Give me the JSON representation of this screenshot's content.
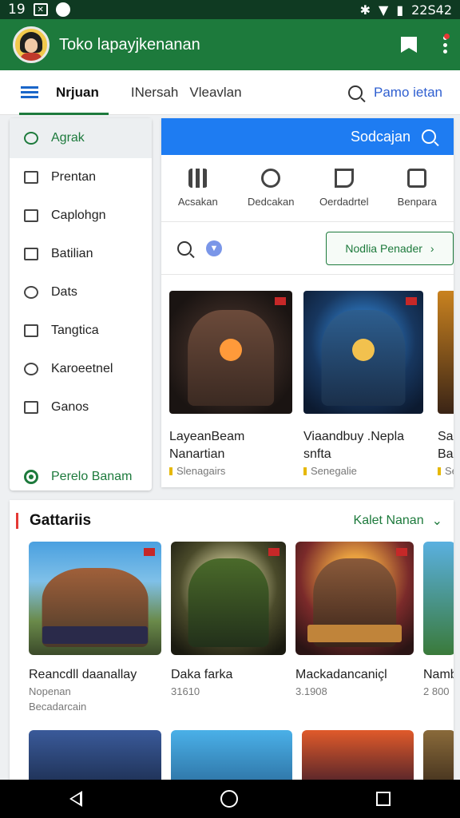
{
  "status_bar": {
    "time": "19",
    "clock": "22S42"
  },
  "app_bar": {
    "title": "Toko lapayjkenanan"
  },
  "tabs": {
    "items": [
      {
        "label": "Nrjuan",
        "active": true
      },
      {
        "label": "INersah"
      },
      {
        "label": "Vleavlan"
      }
    ],
    "search_label": "Pamo ietan"
  },
  "sidebar": {
    "items": [
      {
        "label": "Agrak",
        "icon": "search-icon",
        "active": true
      },
      {
        "label": "Prentan",
        "icon": "card-icon"
      },
      {
        "label": "Caplohgn",
        "icon": "chart-icon"
      },
      {
        "label": "Batilian",
        "icon": "calendar-icon"
      },
      {
        "label": "Dats",
        "icon": "tag-icon"
      },
      {
        "label": "Tangtica",
        "icon": "bag-icon"
      },
      {
        "label": "Karoeetnel",
        "icon": "wrench-icon"
      },
      {
        "label": "Ganos",
        "icon": "apps-icon"
      }
    ],
    "footer_label": "Perelo Banam"
  },
  "panel": {
    "header_label": "Sodcajan",
    "categories": [
      {
        "label": "Acsakan",
        "icon": "grid-icon"
      },
      {
        "label": "Dedcakan",
        "icon": "circle-icon"
      },
      {
        "label": "Oerdadrtel",
        "icon": "flag-icon"
      },
      {
        "label": "Benpara",
        "icon": "clipboard-icon"
      }
    ],
    "action_button": "Nodlia Penader",
    "featured": [
      {
        "title_line1": "LayeanBeam",
        "title_line2": "Nanartian",
        "sub": "Slenagairs"
      },
      {
        "title_line1": "Viaandbuy .Nepla",
        "title_line2": "snfta",
        "sub": "Senegalie"
      },
      {
        "title_line1": "San",
        "title_line2": "Bad",
        "sub": "Se"
      }
    ]
  },
  "games": {
    "title": "Gattariis",
    "more_label": "Kalet Nanan",
    "items": [
      {
        "title": "Reancdll daanallay",
        "sub1": "Nopenan",
        "sub2": "Becadarcain"
      },
      {
        "title": "Daka farka",
        "sub1": "31610",
        "sub2": ""
      },
      {
        "title": "Mackadancaniçl",
        "sub1": "3.1908",
        "sub2": ""
      },
      {
        "title": "Namb",
        "sub1": "2 800",
        "sub2": ""
      }
    ]
  },
  "colors": {
    "primary": "#1d7a3c",
    "accent_blue": "#1e7cf2",
    "status_bar": "#0f3a22"
  }
}
